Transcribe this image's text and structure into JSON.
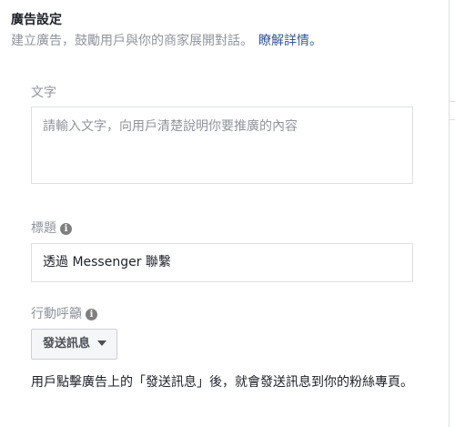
{
  "section": {
    "title": "廣告設定",
    "description": "建立廣告，鼓勵用戶與你的商家展開對話。",
    "learn_more": "瞭解詳情。"
  },
  "text_field": {
    "label": "文字",
    "placeholder": "請輸入文字，向用戶清楚說明你要推廣的內容"
  },
  "headline_field": {
    "label": "標題",
    "value": "透過 Messenger 聯繫",
    "info_icon": "info-icon"
  },
  "cta_field": {
    "label": "行動呼籲",
    "info_icon": "info-icon",
    "selected": "發送訊息",
    "dropdown_icon": "caret-down-icon"
  },
  "help_text": "用戶點擊廣告上的「發送訊息」後，就會發送訊息到你的粉絲專頁。"
}
